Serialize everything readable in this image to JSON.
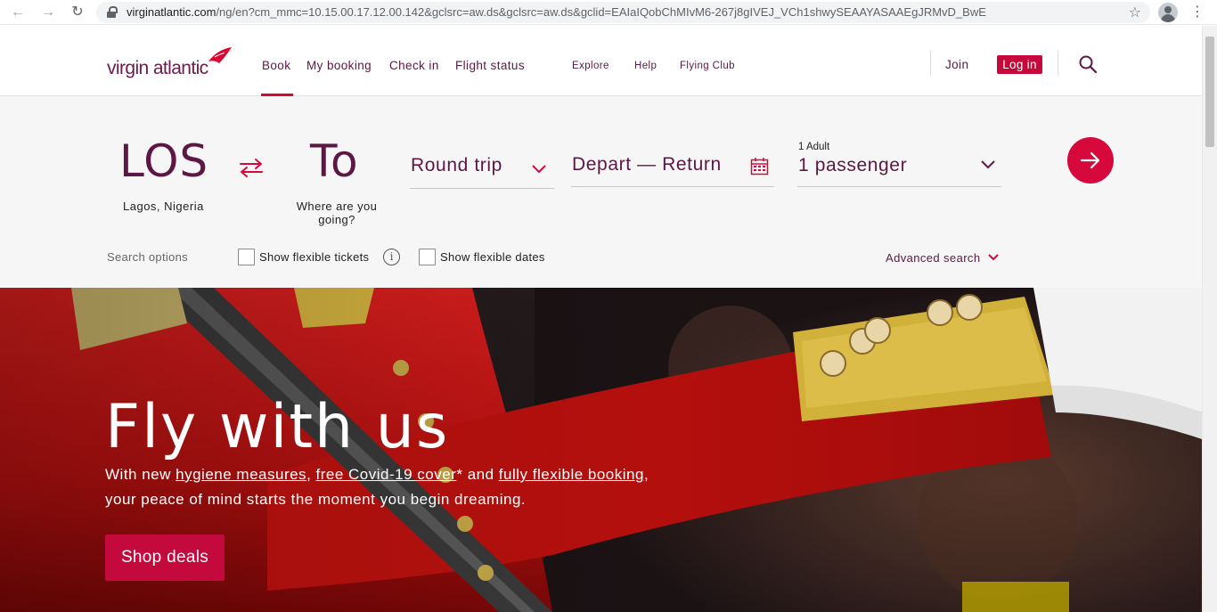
{
  "browser": {
    "url_domain": "virginatlantic.com",
    "url_path": "/ng/en?cm_mmc=10.15.00.17.12.00.142&gclsrc=aw.ds&gclsrc=aw.ds&gclid=EAIaIQobChMIvM6-267j8gIVEJ_VCh1shwySEAAYASAAEgJRMvD_BwE"
  },
  "header": {
    "logo_text": "virgin atlantic",
    "nav": [
      {
        "label": "Book"
      },
      {
        "label": "My booking"
      },
      {
        "label": "Check in"
      },
      {
        "label": "Flight status"
      },
      {
        "label": "Explore"
      },
      {
        "label": "Help"
      },
      {
        "label": "Flying Club"
      }
    ],
    "join_label": "Join",
    "login_label": "Log in"
  },
  "booking": {
    "origin_code": "LOS",
    "origin_city": "Lagos, Nigeria",
    "destination_code": "To",
    "destination_hint": "Where are you going?",
    "trip_type": "Round trip",
    "dates_label": "Depart — Return",
    "passenger_small": "1 Adult",
    "passenger_label": "1 passenger",
    "search_options_label": "Search options",
    "flexible_tickets_label": "Show flexible tickets",
    "flexible_dates_label": "Show flexible dates",
    "advanced_search_label": "Advanced search"
  },
  "hero": {
    "title": "Fly with us",
    "copy_prefix": "With new ",
    "link_hygiene": "hygiene measures",
    "copy_sep1": ", ",
    "link_covid": "free Covid-19 cover",
    "copy_mid": "* and ",
    "link_flexible": "fully flexible booking",
    "copy_suffix": ", your peace of mind starts the moment you begin dreaming.",
    "cta_label": "Shop deals"
  },
  "colors": {
    "brand_plum": "#5c1744",
    "brand_red": "#d7083b",
    "panel_bg": "#f6f6f7"
  }
}
